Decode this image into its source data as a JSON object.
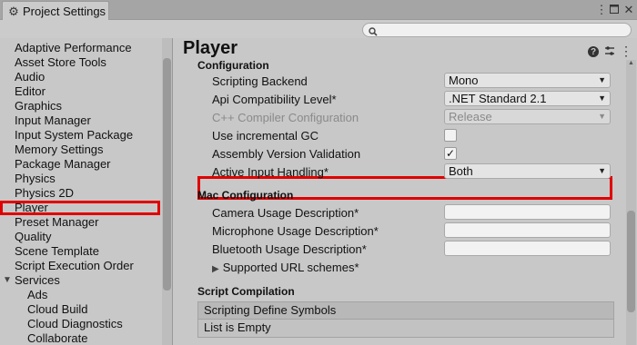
{
  "window": {
    "tab_title": "Project Settings",
    "tab_icon": "gear-icon",
    "menu_icon": "kebab-icon",
    "maximize_icon": "maximize-icon",
    "close_icon": "close-icon"
  },
  "search": {
    "placeholder": "",
    "value": "",
    "icon": "search-icon"
  },
  "sidebar": {
    "items": [
      {
        "label": "Adaptive Performance"
      },
      {
        "label": "Asset Store Tools"
      },
      {
        "label": "Audio"
      },
      {
        "label": "Editor"
      },
      {
        "label": "Graphics"
      },
      {
        "label": "Input Manager"
      },
      {
        "label": "Input System Package"
      },
      {
        "label": "Memory Settings"
      },
      {
        "label": "Package Manager"
      },
      {
        "label": "Physics"
      },
      {
        "label": "Physics 2D"
      },
      {
        "label": "Player",
        "selected": true
      },
      {
        "label": "Preset Manager"
      },
      {
        "label": "Quality"
      },
      {
        "label": "Scene Template"
      },
      {
        "label": "Script Execution Order"
      },
      {
        "label": "Services",
        "expanded": true
      },
      {
        "label": "Ads",
        "child": true
      },
      {
        "label": "Cloud Build",
        "child": true
      },
      {
        "label": "Cloud Diagnostics",
        "child": true
      },
      {
        "label": "Collaborate",
        "child": true
      }
    ]
  },
  "main": {
    "title": "Player",
    "help_icon": "help-icon",
    "preset_icon": "preset-icon",
    "more_icon": "kebab-icon",
    "configuration": {
      "heading": "Configuration",
      "scripting_backend": {
        "label": "Scripting Backend",
        "value": "Mono"
      },
      "api_compat": {
        "label": "Api Compatibility Level*",
        "value": ".NET Standard 2.1"
      },
      "cpp_compiler": {
        "label": "C++ Compiler Configuration",
        "value": "Release",
        "disabled": true
      },
      "incremental_gc": {
        "label": "Use incremental GC",
        "checked": false
      },
      "assembly_validation": {
        "label": "Assembly Version Validation",
        "checked": true,
        "check_glyph": "✓"
      },
      "active_input": {
        "label": "Active Input Handling*",
        "value": "Both"
      }
    },
    "mac_configuration": {
      "heading": "Mac Configuration",
      "camera": {
        "label": "Camera Usage Description*",
        "value": ""
      },
      "microphone": {
        "label": "Microphone Usage Description*",
        "value": ""
      },
      "bluetooth": {
        "label": "Bluetooth Usage Description*",
        "value": ""
      },
      "url_schemes": {
        "label": "Supported URL schemes*"
      }
    },
    "script_compilation": {
      "heading": "Script Compilation",
      "define_symbols_header": "Scripting Define Symbols",
      "list_empty": "List is Empty"
    }
  },
  "colors": {
    "highlight": "#e00000",
    "background": "#c8c8c8"
  }
}
